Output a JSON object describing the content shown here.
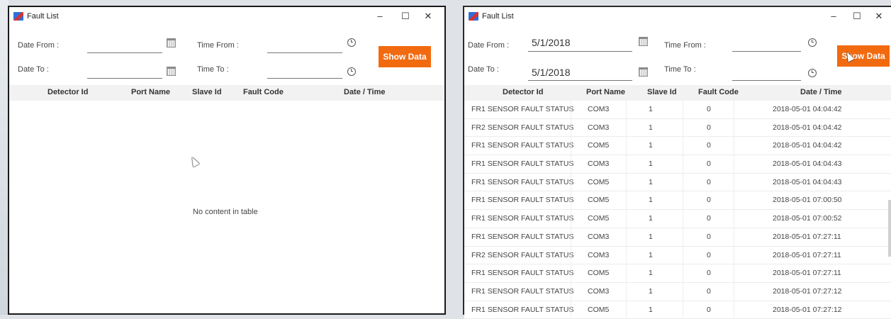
{
  "left_window": {
    "title": "Fault List",
    "controls": {
      "minimize": "–",
      "maximize": "☐",
      "close": "✕"
    },
    "filters": {
      "date_from_label": "Date From :",
      "date_to_label": "Date To :",
      "time_from_label": "Time From :",
      "time_to_label": "Time To :",
      "date_from_value": "",
      "date_to_value": ""
    },
    "show_button": "Show Data",
    "columns": [
      "Detector Id",
      "Port Name",
      "Slave Id",
      "Fault Code",
      "Date / Time"
    ],
    "empty_message": "No content in table"
  },
  "right_window": {
    "title": "Fault List",
    "controls": {
      "minimize": "–",
      "maximize": "☐",
      "close": "✕"
    },
    "filters": {
      "date_from_label": "Date From :",
      "date_to_label": "Date To :",
      "time_from_label": "Time From :",
      "time_to_label": "Time To :",
      "date_from_value": "5/1/2018",
      "date_to_value": "5/1/2018"
    },
    "show_button": "Show Data",
    "columns": [
      "Detector Id",
      "Port Name",
      "Slave Id",
      "Fault Code",
      "Date / Time"
    ],
    "rows": [
      [
        "FR1 SENSOR FAULT STATUS",
        "COM3",
        "1",
        "0",
        "2018-05-01 04:04:42"
      ],
      [
        "FR2 SENSOR FAULT STATUS",
        "COM3",
        "1",
        "0",
        "2018-05-01 04:04:42"
      ],
      [
        "FR1 SENSOR FAULT STATUS",
        "COM5",
        "1",
        "0",
        "2018-05-01 04:04:42"
      ],
      [
        "FR1 SENSOR FAULT STATUS",
        "COM3",
        "1",
        "0",
        "2018-05-01 04:04:43"
      ],
      [
        "FR1 SENSOR FAULT STATUS",
        "COM5",
        "1",
        "0",
        "2018-05-01 04:04:43"
      ],
      [
        "FR1 SENSOR FAULT STATUS",
        "COM5",
        "1",
        "0",
        "2018-05-01 07:00:50"
      ],
      [
        "FR1 SENSOR FAULT STATUS",
        "COM5",
        "1",
        "0",
        "2018-05-01 07:00:52"
      ],
      [
        "FR1 SENSOR FAULT STATUS",
        "COM3",
        "1",
        "0",
        "2018-05-01 07:27:11"
      ],
      [
        "FR2 SENSOR FAULT STATUS",
        "COM3",
        "1",
        "0",
        "2018-05-01 07:27:11"
      ],
      [
        "FR1 SENSOR FAULT STATUS",
        "COM5",
        "1",
        "0",
        "2018-05-01 07:27:11"
      ],
      [
        "FR1 SENSOR FAULT STATUS",
        "COM3",
        "1",
        "0",
        "2018-05-01 07:27:12"
      ],
      [
        "FR1 SENSOR FAULT STATUS",
        "COM5",
        "1",
        "0",
        "2018-05-01 07:27:12"
      ]
    ]
  },
  "colors": {
    "accent": "#f26a10",
    "header_bg": "#f2f2f2"
  },
  "icons": [
    "app-icon",
    "calendar-icon",
    "clock-icon",
    "mouse-cursor-icon"
  ]
}
